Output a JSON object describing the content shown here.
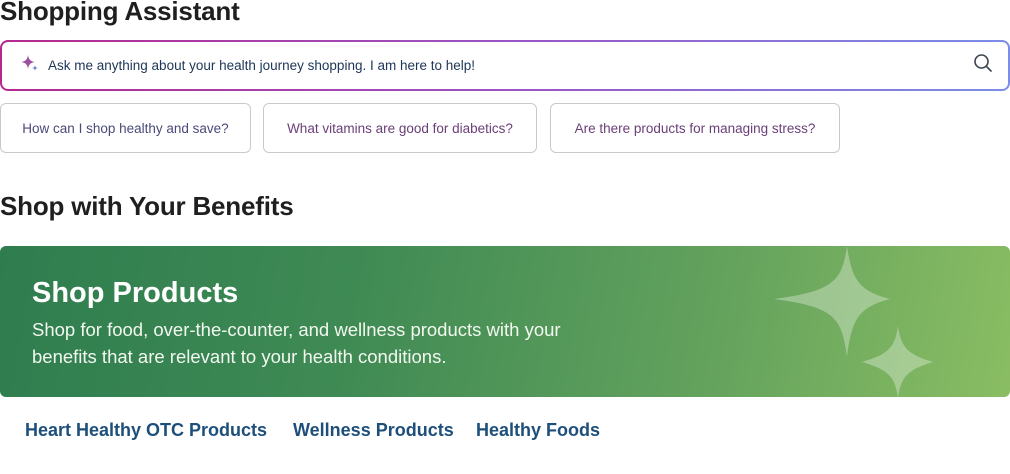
{
  "assistant": {
    "title": "Shopping Assistant",
    "search": {
      "placeholder": "Ask me anything about your health journey shopping. I am here to help!",
      "sparkle_icon": "sparkle-icon",
      "search_icon": "search-icon"
    },
    "suggestions": [
      "How can I shop healthy and save?",
      "What vitamins are good for diabetics?",
      "Are there products for managing stress?"
    ]
  },
  "benefits": {
    "title": "Shop with Your Benefits",
    "banner": {
      "title": "Shop Products",
      "description": "Shop for food, over-the-counter, and wellness products with your benefits that are relevant to your health conditions.",
      "gradient_start": "#2f7d4f",
      "gradient_end": "#8abd63",
      "decoration_icon": "sparkle-stars-icon"
    },
    "links": [
      "Heart Healthy OTC Products",
      "Wellness Products",
      "Healthy Foods"
    ]
  },
  "colors": {
    "accent_magenta": "#b5298f",
    "accent_blue": "#7b8de8",
    "link_blue": "#1d4f7a"
  }
}
